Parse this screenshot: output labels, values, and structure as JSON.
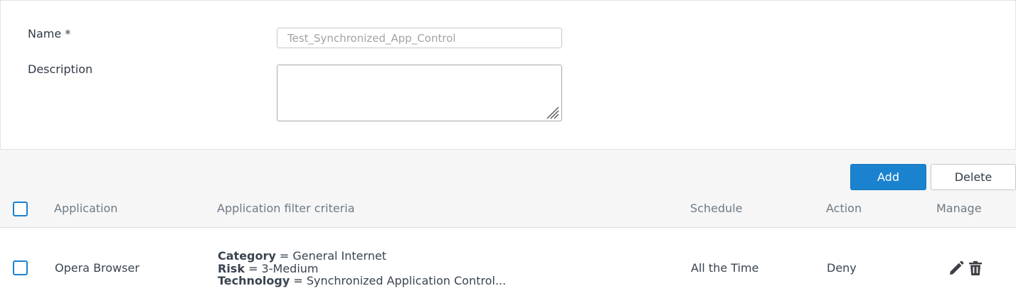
{
  "form": {
    "name_label": "Name *",
    "name_value": "Test_Synchronized_App_Control",
    "description_label": "Description",
    "description_value": ""
  },
  "toolbar": {
    "add_label": "Add",
    "delete_label": "Delete"
  },
  "table": {
    "headers": {
      "application": "Application",
      "criteria": "Application filter criteria",
      "schedule": "Schedule",
      "action": "Action",
      "manage": "Manage"
    },
    "rows": [
      {
        "application": "Opera Browser",
        "criteria": [
          {
            "key": "Category",
            "value": "= General Internet"
          },
          {
            "key": "Risk",
            "value": "= 3-Medium"
          },
          {
            "key": "Technology",
            "value": "= Synchronized Application Control..."
          }
        ],
        "schedule": "All the Time",
        "action": "Deny",
        "manage_icons": [
          "edit-icon",
          "delete-icon"
        ]
      }
    ]
  },
  "colors": {
    "accent": "#1a82ce",
    "text": "#2f3a46",
    "muted": "#6f7a85"
  }
}
